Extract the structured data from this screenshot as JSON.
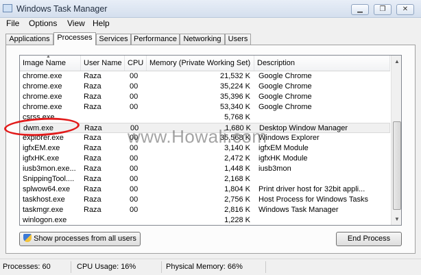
{
  "window": {
    "title": "Windows Task Manager",
    "minimize": "▁",
    "restore": "❐",
    "close": "✕"
  },
  "menu": [
    "File",
    "Options",
    "View",
    "Help"
  ],
  "tabs": [
    "Applications",
    "Processes",
    "Services",
    "Performance",
    "Networking",
    "Users"
  ],
  "active_tab": "Processes",
  "columns": [
    "Image Name",
    "User Name",
    "CPU",
    "Memory (Private Working Set)",
    "Description"
  ],
  "processes": [
    {
      "name": "chrome.exe",
      "user": "Raza",
      "cpu": "00",
      "mem": "21,532 K",
      "desc": "Google Chrome"
    },
    {
      "name": "chrome.exe",
      "user": "Raza",
      "cpu": "00",
      "mem": "35,224 K",
      "desc": "Google Chrome"
    },
    {
      "name": "chrome.exe",
      "user": "Raza",
      "cpu": "00",
      "mem": "35,396 K",
      "desc": "Google Chrome"
    },
    {
      "name": "chrome.exe",
      "user": "Raza",
      "cpu": "00",
      "mem": "53,340 K",
      "desc": "Google Chrome"
    },
    {
      "name": "csrss.exe",
      "user": "",
      "cpu": "",
      "mem": "5,768 K",
      "desc": ""
    },
    {
      "name": "dwm.exe",
      "user": "Raza",
      "cpu": "00",
      "mem": "1,680 K",
      "desc": "Desktop Window Manager"
    },
    {
      "name": "explorer.exe",
      "user": "Raza",
      "cpu": "00",
      "mem": "35,568 K",
      "desc": "Windows Explorer"
    },
    {
      "name": "igfxEM.exe",
      "user": "Raza",
      "cpu": "00",
      "mem": "3,140 K",
      "desc": "igfxEM Module"
    },
    {
      "name": "igfxHK.exe",
      "user": "Raza",
      "cpu": "00",
      "mem": "2,472 K",
      "desc": "igfxHK Module"
    },
    {
      "name": "iusb3mon.exe...",
      "user": "Raza",
      "cpu": "00",
      "mem": "1,448 K",
      "desc": "iusb3mon"
    },
    {
      "name": "SnippingTool....",
      "user": "Raza",
      "cpu": "00",
      "mem": "2,168 K",
      "desc": ""
    },
    {
      "name": "splwow64.exe",
      "user": "Raza",
      "cpu": "00",
      "mem": "1,804 K",
      "desc": "Print driver host for 32bit appli..."
    },
    {
      "name": "taskhost.exe",
      "user": "Raza",
      "cpu": "00",
      "mem": "2,756 K",
      "desc": "Host Process for Windows Tasks"
    },
    {
      "name": "taskmgr.exe",
      "user": "Raza",
      "cpu": "00",
      "mem": "2,816 K",
      "desc": "Windows Task Manager"
    },
    {
      "name": "winlogon.exe",
      "user": "",
      "cpu": "",
      "mem": "1,228 K",
      "desc": ""
    }
  ],
  "selected_process": "dwm.exe",
  "buttons": {
    "show_all": "Show processes from all users",
    "end_process": "End Process"
  },
  "status": {
    "processes": "Processes: 60",
    "cpu": "CPU Usage: 16%",
    "memory": "Physical Memory: 66%"
  },
  "watermark": "www.Howali.com",
  "icons": [
    "app-icon",
    "sort-up-icon",
    "shield-icon",
    "scroll-up-icon",
    "scroll-down-icon"
  ],
  "colors": {
    "highlight_circle": "#e11b1b",
    "selection": "#f0f0f0"
  }
}
